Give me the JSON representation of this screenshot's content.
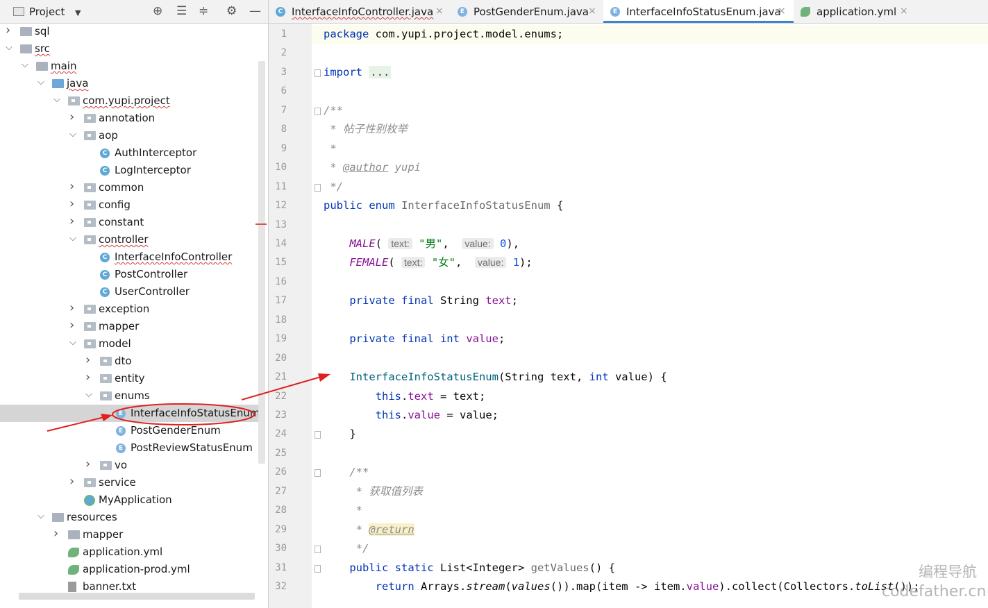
{
  "project_panel": {
    "title": "Project",
    "tree": [
      {
        "label": "sql",
        "depth": 0,
        "expanded": false,
        "icon": "folder-icon"
      },
      {
        "label": "src",
        "depth": 0,
        "expanded": true,
        "icon": "folder-icon",
        "squiggle": true
      },
      {
        "label": "main",
        "depth": 1,
        "expanded": true,
        "icon": "folder-icon",
        "squiggle": true
      },
      {
        "label": "java",
        "depth": 2,
        "expanded": true,
        "icon": "source-folder-icon",
        "squiggle": true
      },
      {
        "label": "com.yupi.project",
        "depth": 3,
        "expanded": true,
        "icon": "package-icon",
        "squiggle": true
      },
      {
        "label": "annotation",
        "depth": 4,
        "expanded": false,
        "icon": "package-icon"
      },
      {
        "label": "aop",
        "depth": 4,
        "expanded": true,
        "icon": "package-icon"
      },
      {
        "label": "AuthInterceptor",
        "depth": 5,
        "icon": "class-icon"
      },
      {
        "label": "LogInterceptor",
        "depth": 5,
        "icon": "class-icon"
      },
      {
        "label": "common",
        "depth": 4,
        "expanded": false,
        "icon": "package-icon"
      },
      {
        "label": "config",
        "depth": 4,
        "expanded": false,
        "icon": "package-icon"
      },
      {
        "label": "constant",
        "depth": 4,
        "expanded": false,
        "icon": "package-icon"
      },
      {
        "label": "controller",
        "depth": 4,
        "expanded": true,
        "icon": "package-icon",
        "squiggle": true
      },
      {
        "label": "InterfaceInfoController",
        "depth": 5,
        "icon": "class-icon",
        "squiggle": true
      },
      {
        "label": "PostController",
        "depth": 5,
        "icon": "class-icon"
      },
      {
        "label": "UserController",
        "depth": 5,
        "icon": "class-icon"
      },
      {
        "label": "exception",
        "depth": 4,
        "expanded": false,
        "icon": "package-icon"
      },
      {
        "label": "mapper",
        "depth": 4,
        "expanded": false,
        "icon": "package-icon"
      },
      {
        "label": "model",
        "depth": 4,
        "expanded": true,
        "icon": "package-icon"
      },
      {
        "label": "dto",
        "depth": 5,
        "expanded": false,
        "icon": "package-icon"
      },
      {
        "label": "entity",
        "depth": 5,
        "expanded": false,
        "icon": "package-icon"
      },
      {
        "label": "enums",
        "depth": 5,
        "expanded": true,
        "icon": "package-icon"
      },
      {
        "label": "InterfaceInfoStatusEnum",
        "depth": 6,
        "icon": "enum-icon",
        "selected": true
      },
      {
        "label": "PostGenderEnum",
        "depth": 6,
        "icon": "enum-icon"
      },
      {
        "label": "PostReviewStatusEnum",
        "depth": 6,
        "icon": "enum-icon"
      },
      {
        "label": "vo",
        "depth": 5,
        "expanded": false,
        "icon": "package-icon"
      },
      {
        "label": "service",
        "depth": 4,
        "expanded": false,
        "icon": "package-icon"
      },
      {
        "label": "MyApplication",
        "depth": 4,
        "icon": "spring-app-icon"
      },
      {
        "label": "resources",
        "depth": 2,
        "expanded": true,
        "icon": "resources-folder-icon"
      },
      {
        "label": "mapper",
        "depth": 3,
        "expanded": false,
        "icon": "folder-icon"
      },
      {
        "label": "application.yml",
        "depth": 3,
        "icon": "yaml-spring-icon"
      },
      {
        "label": "application-prod.yml",
        "depth": 3,
        "icon": "yaml-spring-icon"
      },
      {
        "label": "banner.txt",
        "depth": 3,
        "icon": "text-file-icon"
      }
    ]
  },
  "tabs": [
    {
      "label": "InterfaceInfoController.java",
      "icon": "class-icon",
      "letter": "C",
      "squiggle": true,
      "active": false
    },
    {
      "label": "PostGenderEnum.java",
      "icon": "enum-icon",
      "letter": "E",
      "active": false
    },
    {
      "label": "InterfaceInfoStatusEnum.java",
      "icon": "enum-icon",
      "letter": "E",
      "active": true
    },
    {
      "label": "application.yml",
      "icon": "yaml-spring-icon",
      "letter": "",
      "active": false
    }
  ],
  "close_glyph": "×",
  "editor": {
    "line_numbers": [
      "1",
      "2",
      "3",
      "6",
      "7",
      "8",
      "9",
      "10",
      "11",
      "12",
      "13",
      "14",
      "15",
      "16",
      "17",
      "18",
      "19",
      "20",
      "21",
      "22",
      "23",
      "24",
      "25",
      "26",
      "27",
      "28",
      "29",
      "30",
      "31",
      "32"
    ],
    "fold_lines": [
      "3",
      "7",
      "11",
      "24",
      "26",
      "30",
      "31"
    ],
    "lines": [
      [
        {
          "t": "package ",
          "c": "kw"
        },
        {
          "t": "com.yupi.project.model.enums;",
          "c": ""
        }
      ],
      [],
      [
        {
          "t": "import ",
          "c": "kw"
        },
        {
          "t": "...",
          "c": "import-fold"
        }
      ],
      [],
      [
        {
          "t": "/**",
          "c": "cmt"
        }
      ],
      [
        {
          "t": " * 帖子性别枚举",
          "c": "cmt"
        }
      ],
      [
        {
          "t": " *",
          "c": "cmt"
        }
      ],
      [
        {
          "t": " * ",
          "c": "cmt"
        },
        {
          "t": "@author",
          "c": "tag"
        },
        {
          "t": " yupi",
          "c": "cmt"
        }
      ],
      [
        {
          "t": " */",
          "c": "cmt"
        }
      ],
      [
        {
          "t": "public enum ",
          "c": "kw"
        },
        {
          "t": "InterfaceInfoStatusEnum",
          "c": "gray-cls"
        },
        {
          "t": " {",
          "c": ""
        }
      ],
      [],
      [
        {
          "t": "    ",
          "c": ""
        },
        {
          "t": "MALE",
          "c": "enumc"
        },
        {
          "t": "( ",
          "c": ""
        },
        {
          "t": "text:",
          "c": "hint"
        },
        {
          "t": " ",
          "c": ""
        },
        {
          "t": "\"男\"",
          "c": "str"
        },
        {
          "t": ",  ",
          "c": ""
        },
        {
          "t": "value:",
          "c": "hint"
        },
        {
          "t": " ",
          "c": ""
        },
        {
          "t": "0",
          "c": "num"
        },
        {
          "t": "),",
          "c": ""
        }
      ],
      [
        {
          "t": "    ",
          "c": ""
        },
        {
          "t": "FEMALE",
          "c": "enumc"
        },
        {
          "t": "( ",
          "c": ""
        },
        {
          "t": "text:",
          "c": "hint"
        },
        {
          "t": " ",
          "c": ""
        },
        {
          "t": "\"女\"",
          "c": "str"
        },
        {
          "t": ",  ",
          "c": ""
        },
        {
          "t": "value:",
          "c": "hint"
        },
        {
          "t": " ",
          "c": ""
        },
        {
          "t": "1",
          "c": "num"
        },
        {
          "t": ");",
          "c": ""
        }
      ],
      [],
      [
        {
          "t": "    ",
          "c": ""
        },
        {
          "t": "private final ",
          "c": "kw"
        },
        {
          "t": "String ",
          "c": ""
        },
        {
          "t": "text",
          "c": "field"
        },
        {
          "t": ";",
          "c": ""
        }
      ],
      [],
      [
        {
          "t": "    ",
          "c": ""
        },
        {
          "t": "private final int ",
          "c": "kw"
        },
        {
          "t": "value",
          "c": "field"
        },
        {
          "t": ";",
          "c": ""
        }
      ],
      [],
      [
        {
          "t": "    ",
          "c": ""
        },
        {
          "t": "InterfaceInfoStatusEnum",
          "c": "method"
        },
        {
          "t": "(String text, ",
          "c": ""
        },
        {
          "t": "int",
          "c": "kw"
        },
        {
          "t": " value) {",
          "c": ""
        }
      ],
      [
        {
          "t": "        ",
          "c": ""
        },
        {
          "t": "this",
          "c": "kw"
        },
        {
          "t": ".",
          "c": ""
        },
        {
          "t": "text",
          "c": "field"
        },
        {
          "t": " = text;",
          "c": ""
        }
      ],
      [
        {
          "t": "        ",
          "c": ""
        },
        {
          "t": "this",
          "c": "kw"
        },
        {
          "t": ".",
          "c": ""
        },
        {
          "t": "value",
          "c": "field"
        },
        {
          "t": " = value;",
          "c": ""
        }
      ],
      [
        {
          "t": "    }",
          "c": ""
        }
      ],
      [],
      [
        {
          "t": "    /**",
          "c": "cmt"
        }
      ],
      [
        {
          "t": "     * 获取值列表",
          "c": "cmt"
        }
      ],
      [
        {
          "t": "     *",
          "c": "cmt"
        }
      ],
      [
        {
          "t": "     * ",
          "c": "cmt"
        },
        {
          "t": "@return",
          "c": "tag-hl"
        }
      ],
      [
        {
          "t": "     */",
          "c": "cmt"
        }
      ],
      [
        {
          "t": "    ",
          "c": ""
        },
        {
          "t": "public static ",
          "c": "kw"
        },
        {
          "t": "List<Integer> ",
          "c": ""
        },
        {
          "t": "getValues",
          "c": "gray-cls"
        },
        {
          "t": "() {",
          "c": ""
        }
      ],
      [
        {
          "t": "        ",
          "c": ""
        },
        {
          "t": "return ",
          "c": "kw"
        },
        {
          "t": "Arrays.",
          "c": ""
        },
        {
          "t": "stream",
          "c": "static-m"
        },
        {
          "t": "(",
          "c": ""
        },
        {
          "t": "values",
          "c": "static-m"
        },
        {
          "t": "()).map(item -> item.",
          "c": ""
        },
        {
          "t": "value",
          "c": "field"
        },
        {
          "t": ").collect(Collectors.",
          "c": ""
        },
        {
          "t": "toList",
          "c": "static-m"
        },
        {
          "t": "());",
          "c": ""
        }
      ]
    ]
  },
  "watermark": {
    "line1": "编程导航",
    "line2": "codefather.cn"
  },
  "colors": {
    "accent": "#4083c9",
    "annotation_red": "#e02020",
    "selected_row": "#d5d5d5"
  }
}
